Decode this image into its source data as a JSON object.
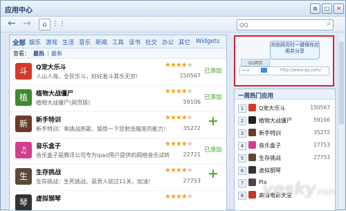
{
  "window": {
    "title": "应用中心"
  },
  "search": {
    "placeholder": "QQ"
  },
  "categories": [
    "全部",
    "娱乐",
    "游戏",
    "生活",
    "音乐",
    "新闻",
    "工具",
    "读书",
    "社交",
    "办公",
    "其它",
    "Widgets"
  ],
  "view": {
    "label": "查看：",
    "hot": "最热",
    "sep": "|",
    "new": "最新"
  },
  "apps": [
    {
      "name": "Q宠大乐斗",
      "desc": "人山人海，全民乐斗，好好发斗其乐无穷!",
      "count": "150567",
      "rating": 4,
      "status": "已添加",
      "color": "#d23a2a",
      "glyph": "斗"
    },
    {
      "name": "植物大战僵尸",
      "desc": "植物大战僵尸(网页版)",
      "count": "59106",
      "rating": 4,
      "status": "已添加",
      "color": "#3f8a2f",
      "glyph": "植"
    },
    {
      "name": "新手特训",
      "desc": "新手特训：来挑战燕歌，锻炼一下您射击瞄准的能力！",
      "count": "35272",
      "rating": 4,
      "status": "",
      "color": "#6b3a2a",
      "glyph": "新"
    },
    {
      "name": "音乐盒子",
      "desc": "音乐盒子是腾讯公司专为ipad用户提供的网络音乐试听",
      "count": "22721",
      "rating": 4,
      "status": "已添加",
      "color": "#d43f8d",
      "glyph": "♫"
    },
    {
      "name": "生存挑战",
      "desc": "生存挑战：生死挑战，是男人就过11关，加油！",
      "count": "27753",
      "rating": 4,
      "status": "",
      "color": "#5a4a3a",
      "glyph": "生"
    },
    {
      "name": "虚拟钢琴",
      "desc": "",
      "count": "",
      "rating": 4,
      "status": "",
      "color": "#333333",
      "glyph": "琴"
    }
  ],
  "promo": {
    "tip": "浏览网页时一键保存应用并分享",
    "tab": "QQ网页",
    "url": "http://www.qq.com/"
  },
  "hot": {
    "title": "一周热门应用",
    "items": [
      {
        "rank": "1",
        "name": "Q宠大乐斗",
        "count": "150567",
        "color": "#d23a2a"
      },
      {
        "rank": "2",
        "name": "植物大战僵尸",
        "count": "59106",
        "color": "#222222"
      },
      {
        "rank": "3",
        "name": "新手特训",
        "count": "35272",
        "color": "#6b3a2a"
      },
      {
        "rank": "4",
        "name": "音乐盒子",
        "count": "27753",
        "color": "#d43f8d"
      },
      {
        "rank": "5",
        "name": "生存挑战",
        "count": "27753",
        "color": "#5a4a3a"
      },
      {
        "rank": "6",
        "name": "虚拟钢琴",
        "count": "",
        "color": "#333333"
      },
      {
        "rank": "7",
        "name": "Pix",
        "count": "",
        "color": "#4a4a4a"
      },
      {
        "rank": "8",
        "name": "高清电影天堂",
        "count": "",
        "color": "#c0392b"
      }
    ]
  },
  "watermark": {
    "brand": "yesky",
    "sub": "天极网"
  }
}
